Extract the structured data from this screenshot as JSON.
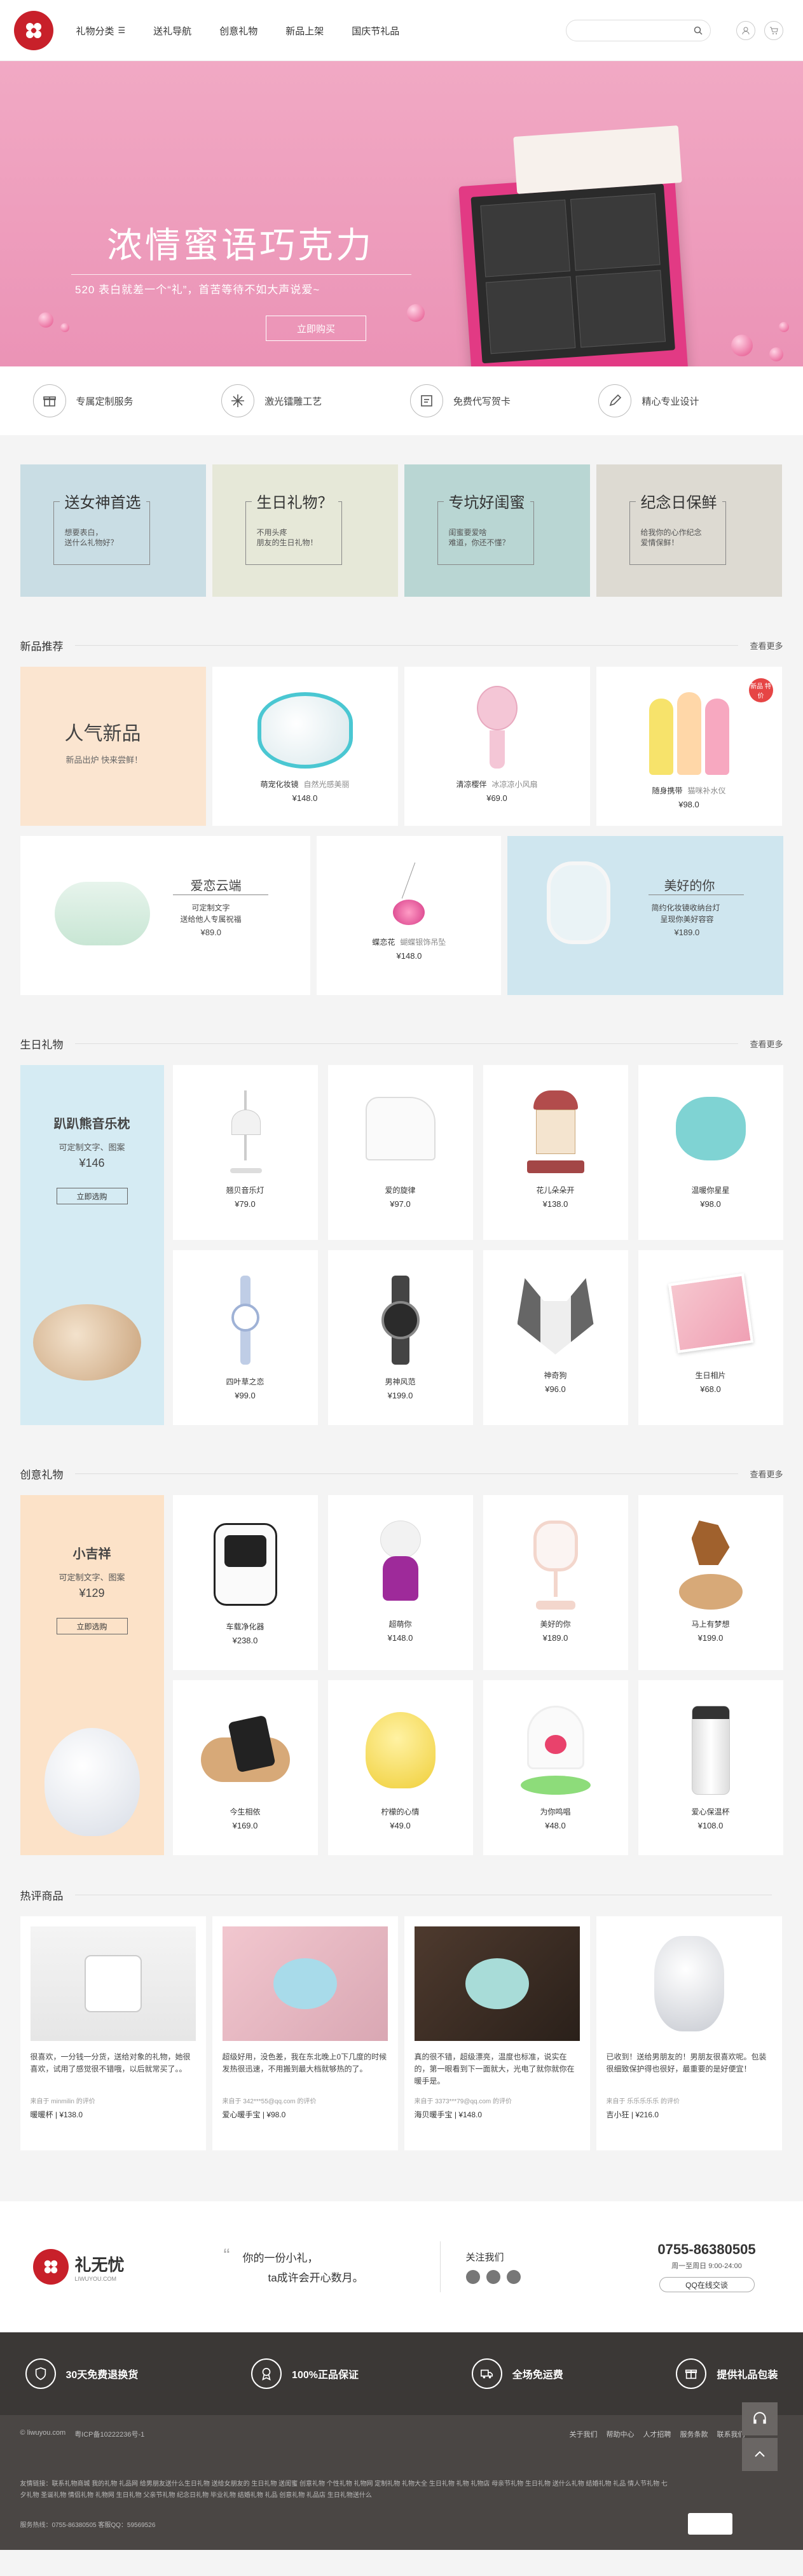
{
  "header": {
    "nav": [
      "礼物分类",
      "送礼导航",
      "创意礼物",
      "新品上架",
      "国庆节礼品"
    ]
  },
  "banner": {
    "title": "浓情蜜语巧克力",
    "subtitle": "520 表白就差一个“礼”，首苦等待不如大声说爱~",
    "button": "立即购买",
    "slides": 5
  },
  "services": [
    {
      "label": "专属定制服务",
      "icon": "gift-box-icon"
    },
    {
      "label": "激光镭雕工艺",
      "icon": "laser-icon"
    },
    {
      "label": "免费代写贺卡",
      "icon": "card-icon"
    },
    {
      "label": "精心专业设计",
      "icon": "pen-icon"
    }
  ],
  "promos": [
    {
      "title": "送女神首选",
      "line1": "想要表白，",
      "line2": "送什么礼物好？",
      "bg": "#c9dde4"
    },
    {
      "title": "生日礼物？",
      "line1": "不用头疼",
      "line2": "朋友的生日礼物！",
      "bg": "#e6e8d8"
    },
    {
      "title": "专坑好闺蜜",
      "line1": "闺蜜要爱啥",
      "line2": "难道，你还不懂？",
      "bg": "#b9d6d3"
    },
    {
      "title": "纪念日保鲜",
      "line1": "给我你的心作纪念",
      "line2": "爱情保鲜！",
      "bg": "#dddad2"
    }
  ],
  "new_section": {
    "title": "新品推荐",
    "more": "查看更多",
    "feature": {
      "title": "人气新品",
      "sub": "新品出炉 快来尝鲜！"
    },
    "row1": [
      {
        "name": "萌宠化妆镜",
        "desc": "自然光感美丽",
        "price": "¥148.0"
      },
      {
        "name": "清凉樱伴",
        "desc": "冰凉凉小风扇",
        "price": "¥69.0"
      },
      {
        "name": "随身携带",
        "desc": "猫咪补水仪",
        "price": "¥98.0",
        "badge": "新品 特价"
      }
    ],
    "row2": [
      {
        "title": "爱恋云端",
        "line1": "可定制文字",
        "line2": "送给他人专属祝福",
        "price": "¥89.0"
      },
      {
        "name": "蝶恋花",
        "desc": "蝴蝶银饰吊坠",
        "price": "¥148.0"
      },
      {
        "title": "美好的你",
        "line1": "简约化妆镜收纳台灯",
        "line2": "呈现你美好容容",
        "price": "¥189.0"
      }
    ]
  },
  "birthday_section": {
    "title": "生日礼物",
    "more": "查看更多",
    "feature": {
      "title": "趴趴熊音乐枕",
      "sub": "可定制文字、图案",
      "price": "¥146",
      "button": "立即选购"
    },
    "items": [
      {
        "name": "翘贝音乐灯",
        "price": "¥79.0"
      },
      {
        "name": "爱的旋律",
        "price": "¥97.0"
      },
      {
        "name": "花儿朵朵开",
        "price": "¥138.0"
      },
      {
        "name": "温暖你星星",
        "price": "¥98.0"
      },
      {
        "name": "四叶草之恋",
        "price": "¥99.0"
      },
      {
        "name": "男神风范",
        "price": "¥199.0"
      },
      {
        "name": "神奇狗",
        "price": "¥96.0"
      },
      {
        "name": "生日相片",
        "price": "¥68.0"
      }
    ]
  },
  "creative_section": {
    "title": "创意礼物",
    "more": "查看更多",
    "feature": {
      "title": "小吉祥",
      "sub": "可定制文字、图案",
      "price": "¥129",
      "button": "立即选购"
    },
    "items": [
      {
        "name": "车载净化器",
        "price": "¥238.0"
      },
      {
        "name": "超萌你",
        "price": "¥148.0"
      },
      {
        "name": "美好的你",
        "price": "¥189.0"
      },
      {
        "name": "马上有梦想",
        "price": "¥199.0"
      },
      {
        "name": "今生相依",
        "price": "¥169.0"
      },
      {
        "name": "柠檬的心情",
        "price": "¥49.0"
      },
      {
        "name": "为你鸣唱",
        "price": "¥48.0"
      },
      {
        "name": "爱心保温杯",
        "price": "¥108.0"
      }
    ]
  },
  "hot_section": {
    "title": "热评商品",
    "items": [
      {
        "review": "很喜欢，一分钱一分货，送给对象的礼物，她很喜欢，试用了感觉很不错哦，以后就常买了。。",
        "from": "来自于 minmilin 的评价",
        "name": "暖暖杯",
        "price": "¥138.0"
      },
      {
        "review": "超级好用，没色差，我在东北晚上0下几度的时候发热很迅速，不用搬到最大档就够热的了。",
        "from": "来自于 342***55@qq.com 的评价",
        "name": "爱心暖手宝",
        "price": "¥98.0"
      },
      {
        "review": "真的很不错，超级漂亮，温度也标准，说实在的，第一眼看到下一面就大，光电了就你就你在暖手是。",
        "from": "来自于 3373***79@qq.com 的评价",
        "name": "海贝暖手宝",
        "price": "¥148.0"
      },
      {
        "review": "已收到！送给男朋友的！男朋友很喜欢呢。包装很细致保护得也很好，最重要的是好便宜！",
        "from": "来自于 乐乐乐乐乐 的评价",
        "name": "吉小狂",
        "price": "¥216.0"
      }
    ]
  },
  "footer": {
    "brand": "礼无忧",
    "brand_en": "LIWUYOU.COM",
    "slogan1": "你的一份小礼，",
    "slogan2": "ta成许会开心数月。",
    "follow": "关注我们",
    "phone": "0755-86380505",
    "hours": "周一至周日 9:00-24:00",
    "qq": "QQ在线交谈",
    "guarantees": [
      "30天免费退换货",
      "100%正品保证",
      "全场免运费",
      "提供礼品包装"
    ],
    "icp_site": "© liwuyou.com",
    "icp": "粤ICP备10222236号-1",
    "links": [
      "关于我们",
      "帮助中心",
      "人才招聘",
      "服务条款",
      "联系我们"
    ],
    "friend_links": "友情链接：联系礼物商城 我的礼物 礼品网 给男朋友送什么生日礼物 送给女朋友的 生日礼物 送闺蜜 创意礼物 个性礼物 礼物网 定制礼物 礼物大全 生日礼物 礼物 礼物店 母亲节礼物 生日礼物 送什么礼物 结婚礼物 礼品 情人节礼物 七夕礼物 圣诞礼物 情侣礼物 礼物网 生日礼物 父亲节礼物 纪念日礼物 毕业礼物 结婚礼物 礼品 创意礼物 礼品店 生日礼物送什么",
    "service_line": "服务热线：0755-86380505  客服QQ：59569526"
  }
}
